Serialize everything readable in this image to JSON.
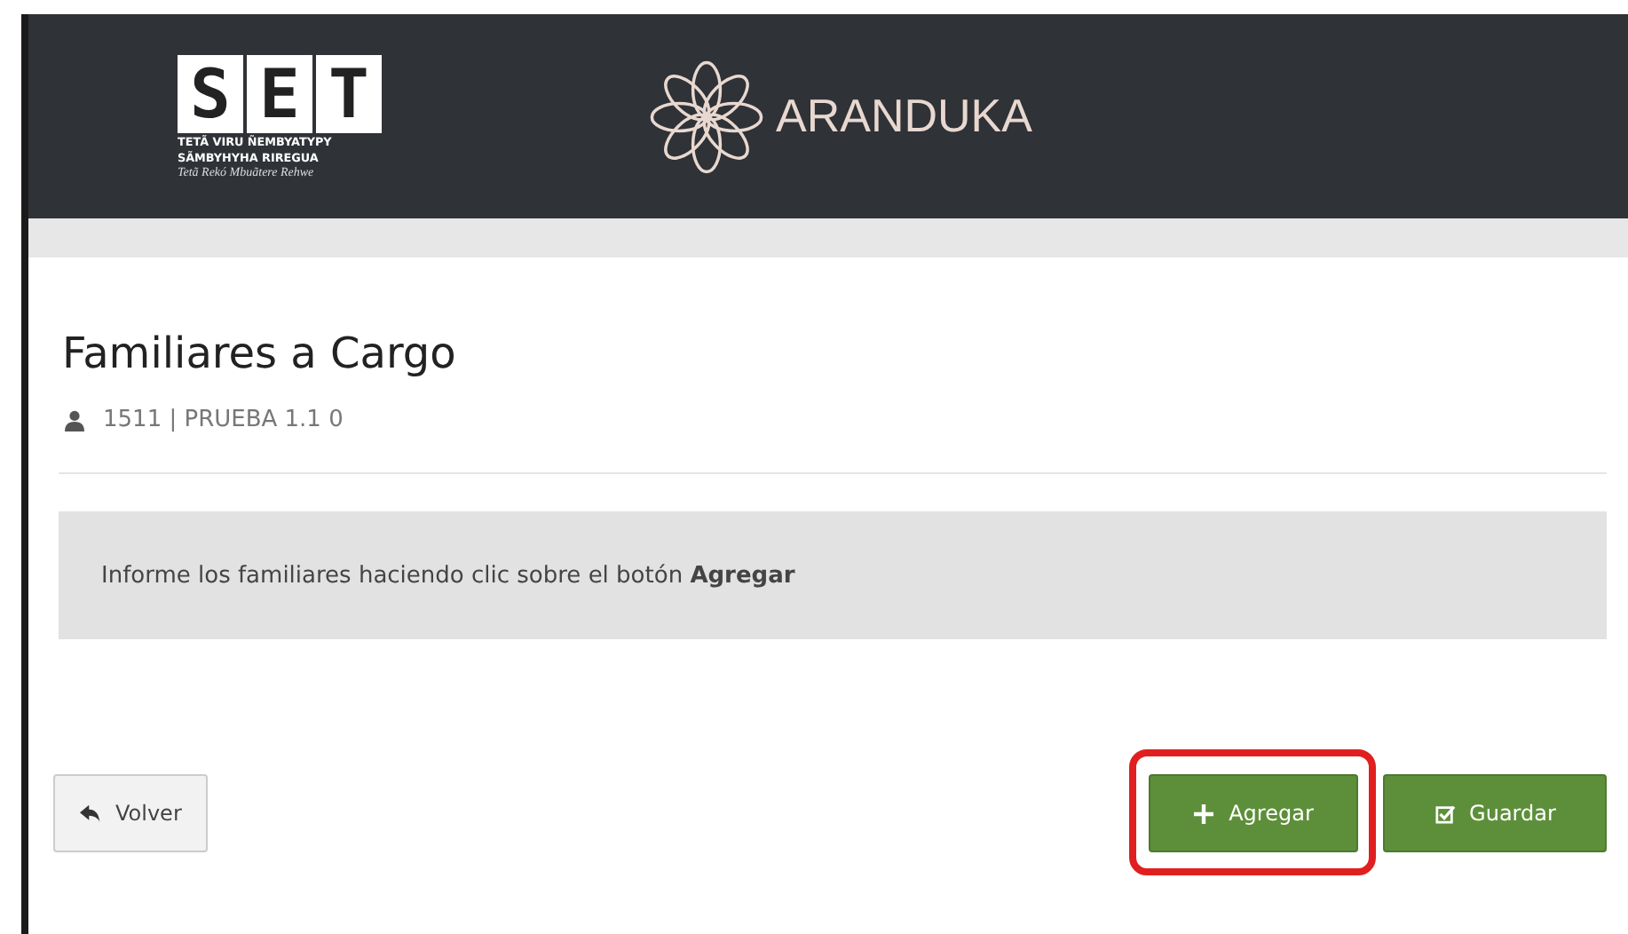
{
  "header": {
    "logo_letters": [
      "S",
      "E",
      "T"
    ],
    "logo_lines": [
      "TETÃ VIRU ÑEMBYATYPY",
      "SÃMBYHYHA RIREGUA"
    ],
    "logo_motto": "Tetã Rekó Mbuãtere Rehwe",
    "brand": "ARANDUKA"
  },
  "page": {
    "title": "Familiares a Cargo",
    "subtitle": "1511 | PRUEBA 1.1 0"
  },
  "notice": "Informe los familiares haciendo clic sobre el botón **Agregar**",
  "buttons": [
    {
      "kind": "back",
      "label": "Volver",
      "highlighted": false
    },
    {
      "kind": "add",
      "label": "Agregar",
      "highlighted": true
    },
    {
      "kind": "save",
      "label": "Guardar",
      "highlighted": false
    }
  ]
}
